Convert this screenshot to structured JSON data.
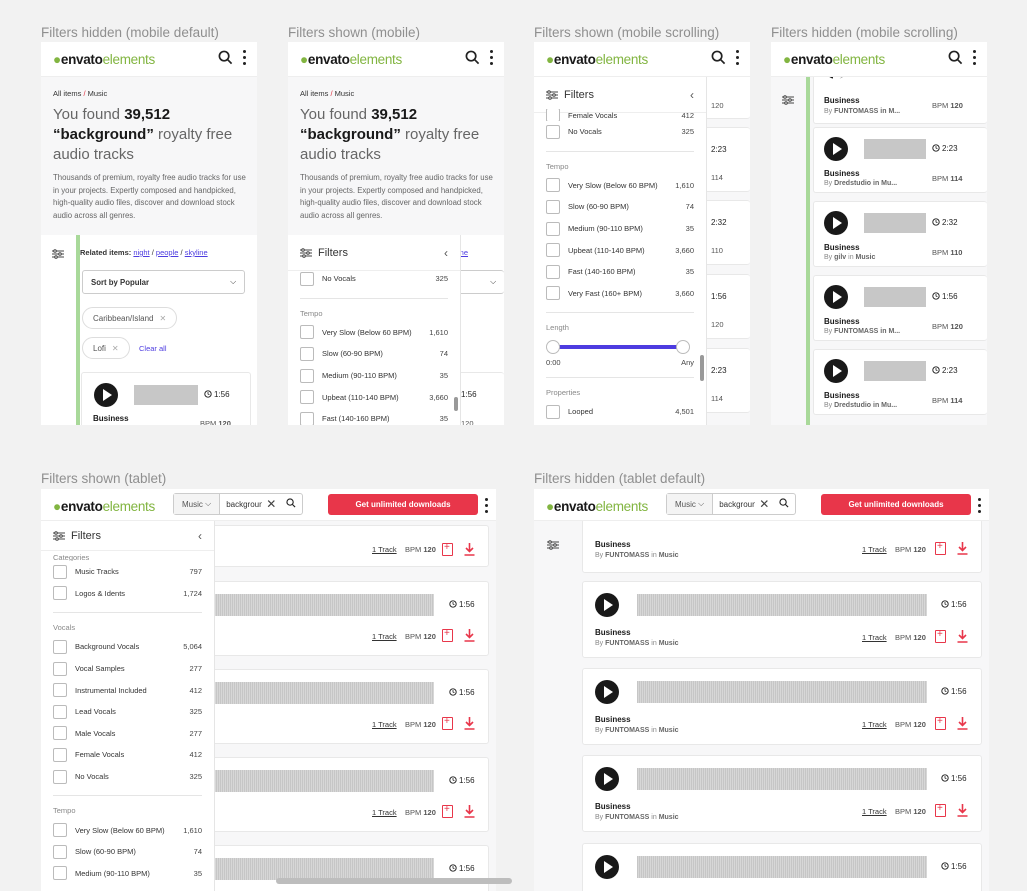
{
  "titles": {
    "p1": "Filters hidden (mobile default)",
    "p2": "Filters shown (mobile)",
    "p3": "Filters shown (mobile scrolling)",
    "p4": "Filters hidden (mobile scrolling)",
    "p5": "Filters shown (tablet)",
    "p6": "Filters hidden (tablet default)"
  },
  "brand": {
    "main": "envato",
    "suffix": "elements",
    "color": "#82b541"
  },
  "accent": "#e8364a",
  "mobile_page": {
    "breadcrumb_root": "All items",
    "breadcrumb_sep": "/",
    "breadcrumb_leaf": "Music",
    "heading_pre": "You found ",
    "heading_count": "39,512",
    "heading_query": "“background”",
    "heading_post": " royalty free audio tracks",
    "description": "Thousands of premium, royalty free audio tracks for use in your projects. Expertly composed and handpicked, high-quality audio files, discover and download stock audio across all genres.",
    "related_label": "Related items:",
    "related": [
      "night",
      "people",
      "skyline"
    ],
    "sort_label": "Sort by Popular",
    "chips": [
      "Caribbean/Island",
      "Lofi"
    ],
    "clear_all": "Clear all"
  },
  "filters": {
    "title": "Filters",
    "sections": {
      "categories": "Categories",
      "vocals": "Vocals",
      "tempo": "Tempo",
      "length": "Length",
      "properties": "Properties"
    },
    "categories": [
      {
        "label": "Music Tracks",
        "count": "797"
      },
      {
        "label": "Logos & Idents",
        "count": "1,724"
      }
    ],
    "vocals": [
      {
        "label": "Background Vocals",
        "count": "5,064"
      },
      {
        "label": "Vocal Samples",
        "count": "277"
      },
      {
        "label": "Instrumental Included",
        "count": "412"
      },
      {
        "label": "Lead Vocals",
        "count": "325"
      },
      {
        "label": "Male Vocals",
        "count": "277"
      },
      {
        "label": "Female Vocals",
        "count": "412"
      },
      {
        "label": "No Vocals",
        "count": "325"
      }
    ],
    "tempo": [
      {
        "label": "Very Slow (Below 60 BPM)",
        "count": "1,610"
      },
      {
        "label": "Slow (60-90 BPM)",
        "count": "74"
      },
      {
        "label": "Medium (90-110 BPM)",
        "count": "35"
      },
      {
        "label": "Upbeat (110-140 BPM)",
        "count": "3,660"
      },
      {
        "label": "Fast (140-160 BPM)",
        "count": "35"
      },
      {
        "label": "Very Fast (160+ BPM)",
        "count": "3,660"
      }
    ],
    "length_min": "0:00",
    "length_max": "Any",
    "properties": [
      {
        "label": "Looped",
        "count": "4,501"
      }
    ]
  },
  "tracks": {
    "t1": {
      "title": "Business",
      "by": "By",
      "author": "FUNTOMASS",
      "in": "in",
      "cat": "Music",
      "author_short": "FUNTOMASS in M...",
      "duration": "1:56",
      "bpm_label": "BPM",
      "bpm": "120"
    },
    "t2": {
      "title": "Business",
      "author_short": "Dredstudio in Mu...",
      "duration": "2:23",
      "bpm": "114"
    },
    "t3": {
      "title": "Business",
      "by": "By",
      "author": "gilv",
      "in": "in",
      "cat": "Music",
      "duration": "2:32",
      "bpm": "110"
    },
    "track_link": "1 Track"
  },
  "tablet": {
    "search_category": "Music",
    "search_query": "background",
    "cta": "Get unlimited downloads"
  }
}
